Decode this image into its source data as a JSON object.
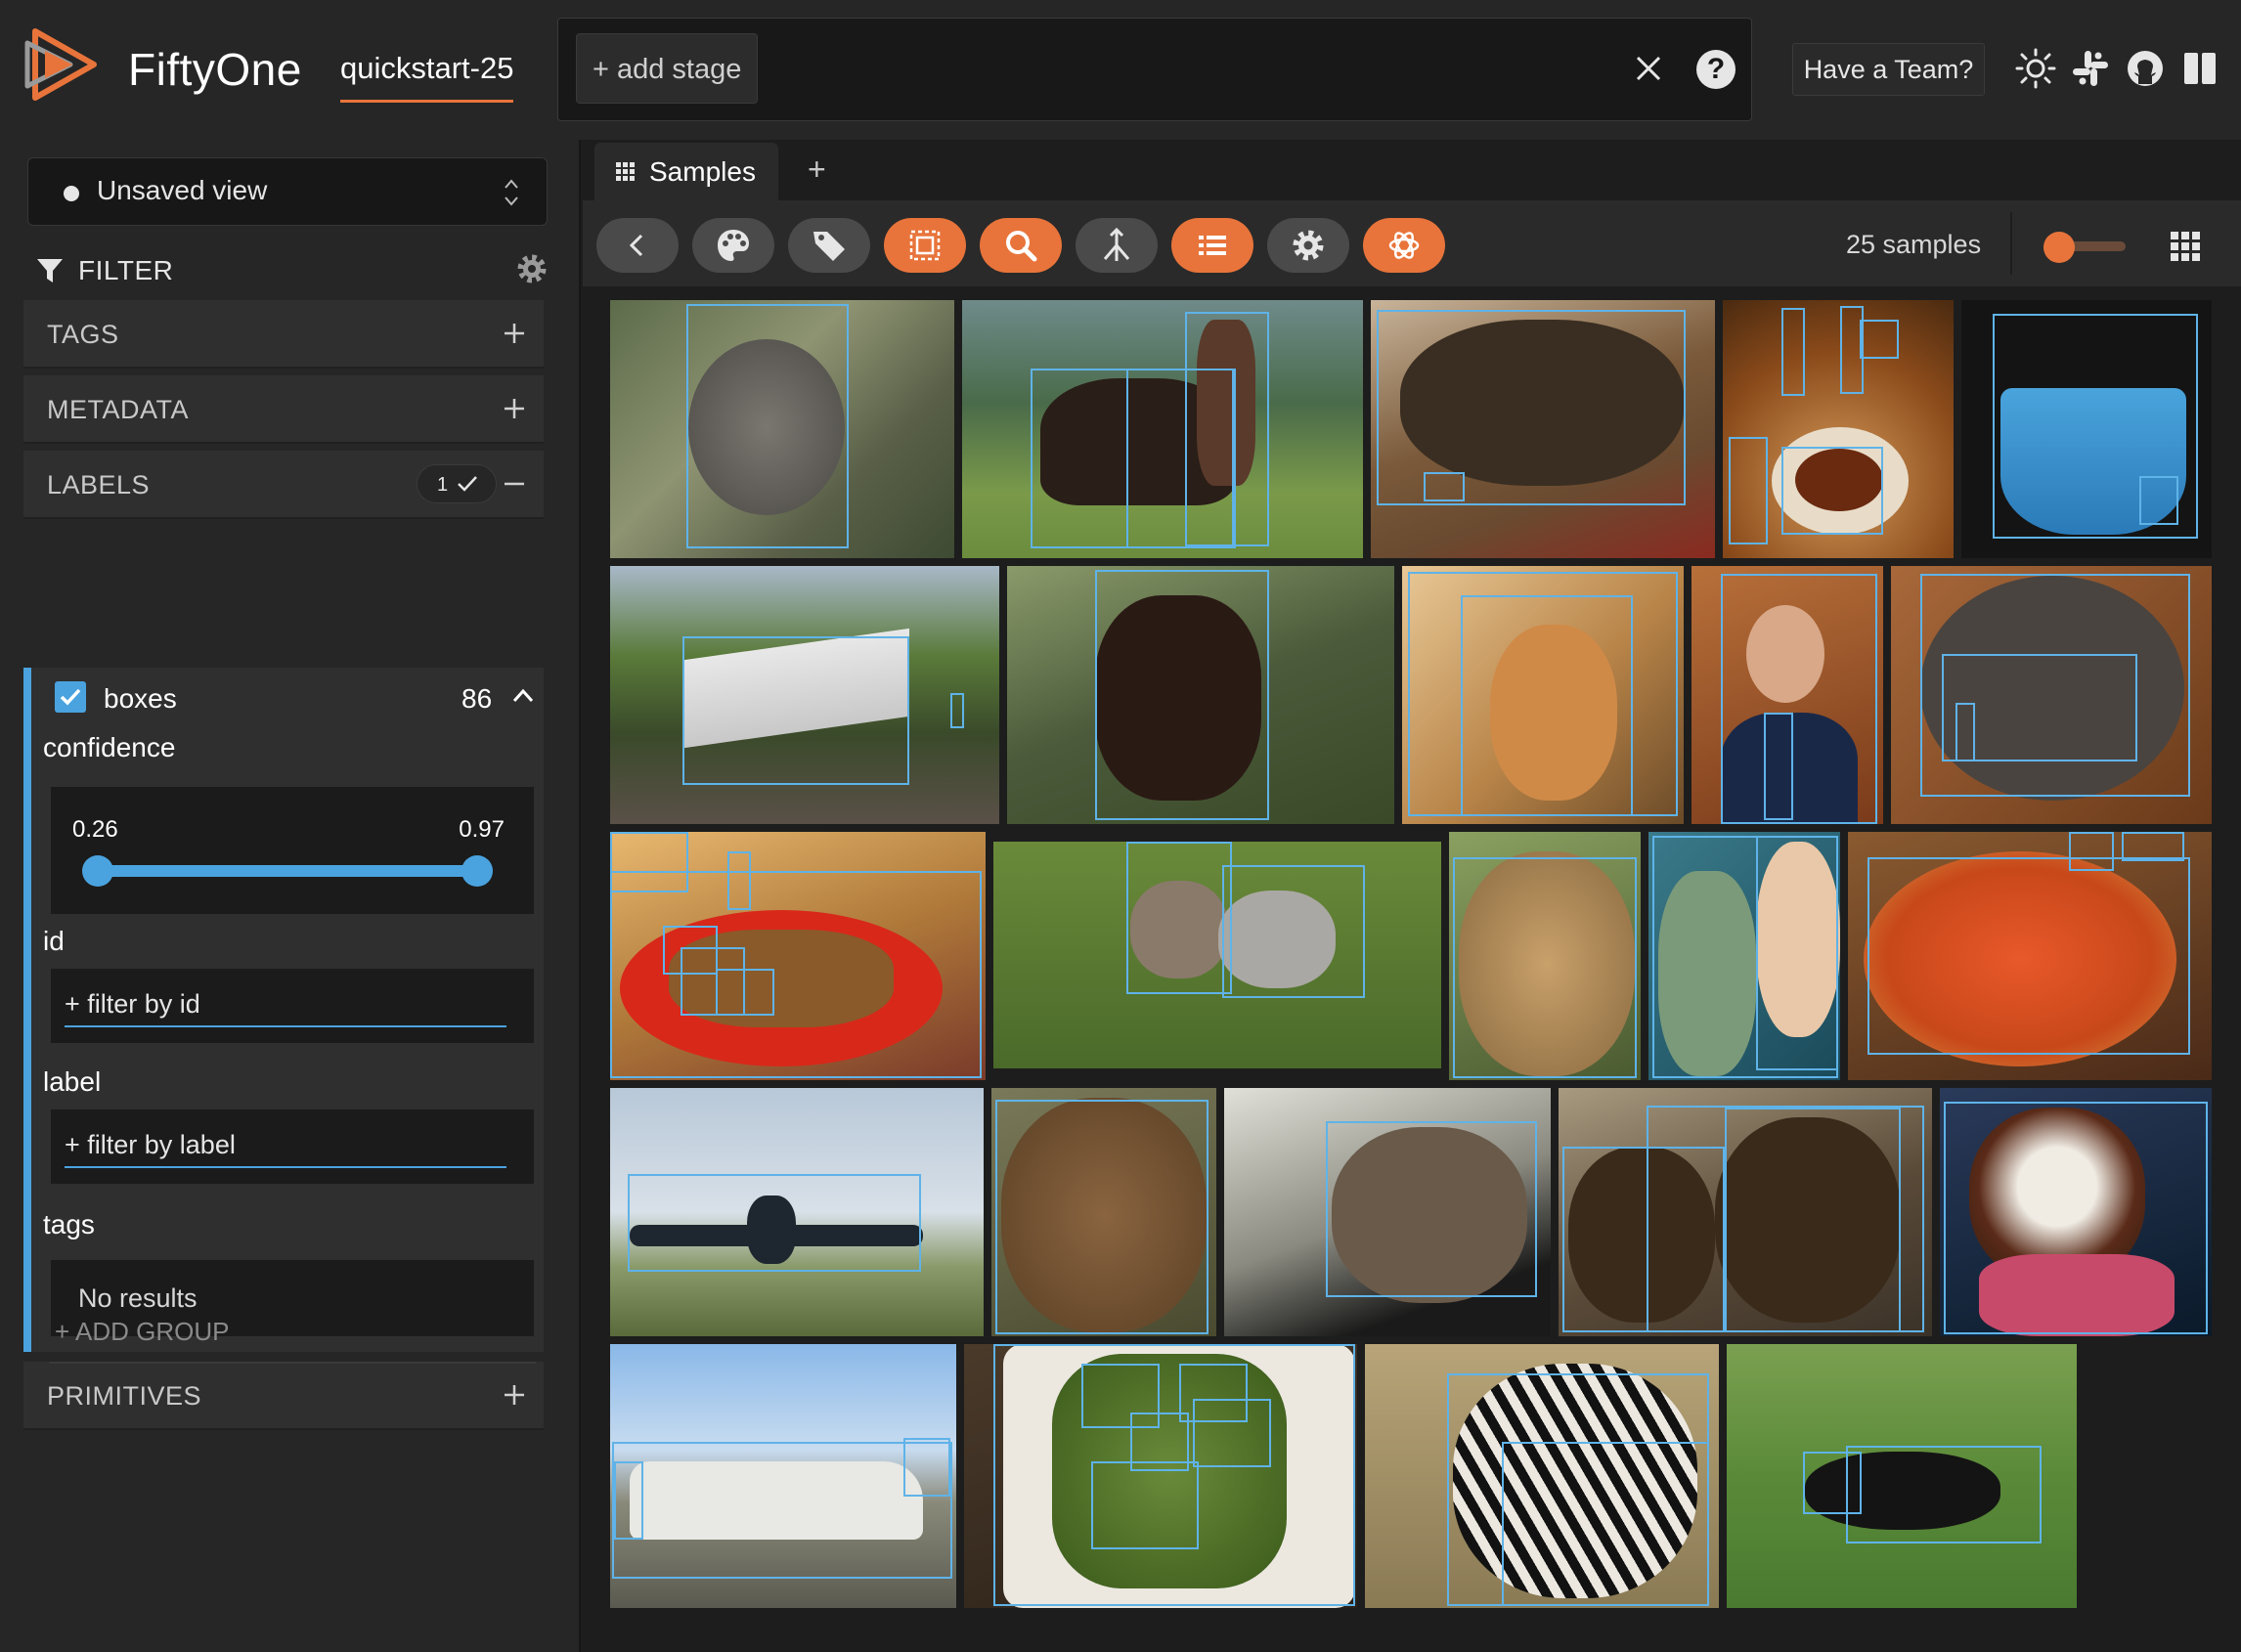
{
  "header": {
    "brand": "FiftyOne",
    "dataset": "quickstart-25",
    "add_stage": "+ add stage",
    "help": "?",
    "team_button": "Have a Team?",
    "icons": [
      "sun-icon",
      "slack-icon",
      "github-icon",
      "book-icon"
    ]
  },
  "sidebar": {
    "view_select": "Unsaved view",
    "filter_title": "FILTER",
    "groups": {
      "tags": "TAGS",
      "metadata": "METADATA",
      "labels": "LABELS",
      "labels_badge": "1",
      "primitives": "PRIMITIVES"
    },
    "boxes": {
      "label": "boxes",
      "count": "86",
      "confidence_label": "confidence",
      "confidence_min": "0.26",
      "confidence_max": "0.97",
      "id_label": "id",
      "id_placeholder": "+ filter by id",
      "label_label": "label",
      "label_placeholder": "+ filter by label",
      "tags_label": "tags",
      "tags_empty": "No results"
    },
    "add_group": "+ ADD GROUP"
  },
  "main": {
    "tab_label": "Samples",
    "tab_add": "+",
    "samples_count": "25 samples",
    "toolbar_buttons": [
      "back",
      "color-scheme",
      "tag",
      "patches",
      "similarity-search",
      "embeddings",
      "label-list",
      "settings",
      "openai"
    ],
    "active_buttons": [
      "patches",
      "similarity-search",
      "label-list",
      "openai"
    ],
    "zoom_level": 0.15
  },
  "colors": {
    "accent": "#e8743b",
    "box": "#5fb3e8",
    "bg": "#1d1d1d"
  }
}
